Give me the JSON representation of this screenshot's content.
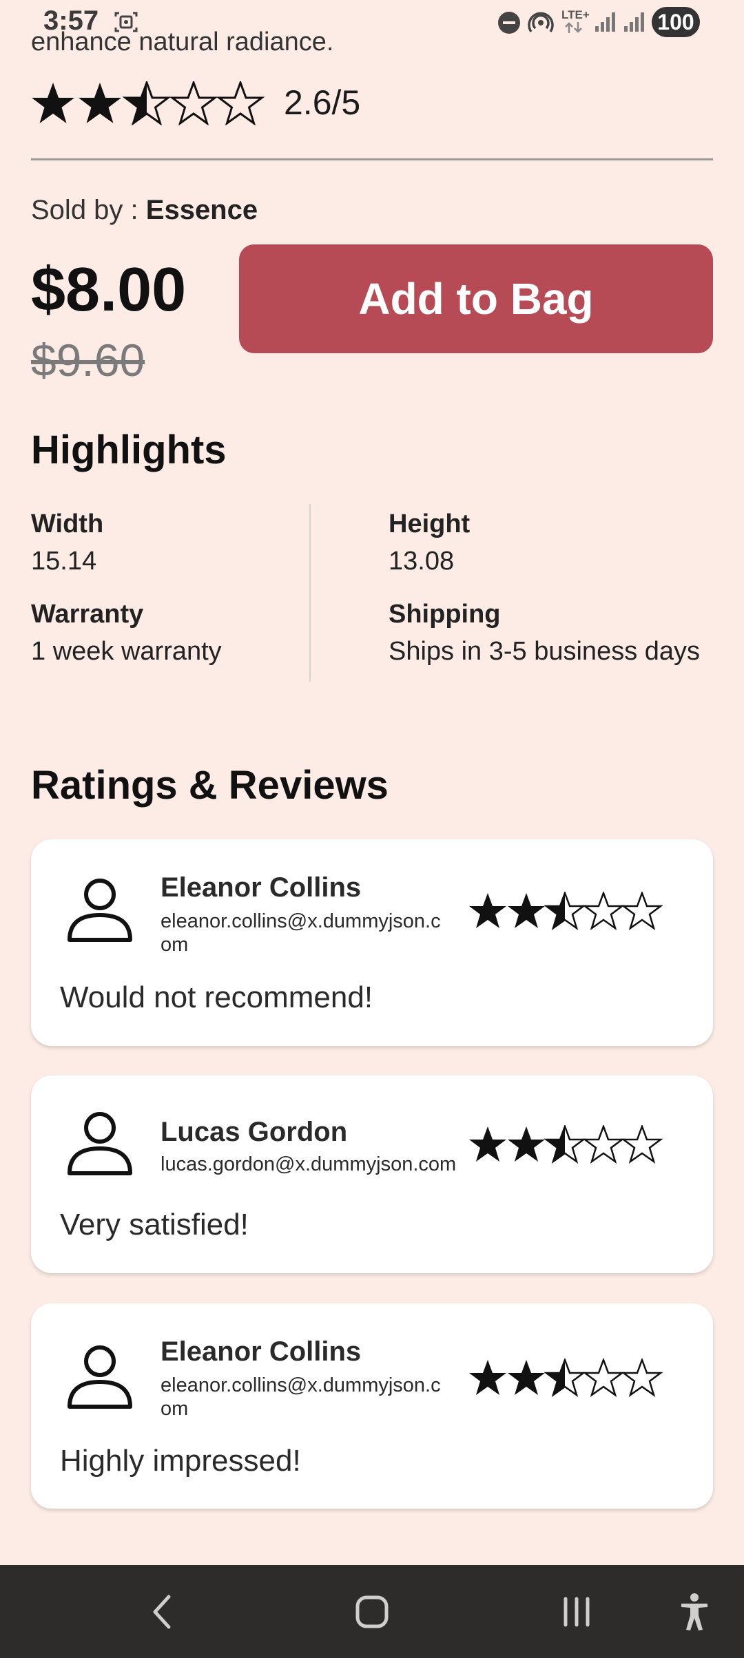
{
  "status_bar": {
    "time": "3:57",
    "network": "LTE+",
    "battery": "100"
  },
  "product": {
    "description_cut": "enhance natural radiance.",
    "rating_text": "2.6/5",
    "rating_value": 2.6,
    "sold_by_label": "Sold by : ",
    "brand": "Essence",
    "price": "$8.00",
    "original_price": "$9.60",
    "add_to_bag_label": "Add to Bag"
  },
  "highlights": {
    "title": "Highlights",
    "items": [
      {
        "label": "Width",
        "value": "15.14"
      },
      {
        "label": "Height",
        "value": "13.08"
      },
      {
        "label": "Warranty",
        "value": "1 week warranty"
      },
      {
        "label": "Shipping",
        "value": "Ships in 3-5 business days"
      }
    ]
  },
  "reviews": {
    "title": "Ratings & Reviews",
    "items": [
      {
        "name": "Eleanor Collins",
        "email": "eleanor.collins@x.dummyjson.com",
        "rating": 2.5,
        "comment": "Would not recommend!"
      },
      {
        "name": "Lucas Gordon",
        "email": "lucas.gordon@x.dummyjson.com",
        "rating": 2.5,
        "comment": "Very satisfied!"
      },
      {
        "name": "Eleanor Collins",
        "email": "eleanor.collins@x.dummyjson.com",
        "rating": 2.5,
        "comment": "Highly impressed!"
      }
    ]
  },
  "icons": {
    "star_filled": "star-filled-icon",
    "star_half": "star-half-icon",
    "star_empty": "star-outline-icon",
    "avatar": "person-icon",
    "back": "back-icon",
    "home": "home-icon",
    "recents": "recents-icon",
    "accessibility": "accessibility-icon"
  },
  "colors": {
    "background": "#fdece6",
    "accent": "#b64a55",
    "card": "#ffffff",
    "nav_bar": "#2e2b2b"
  }
}
